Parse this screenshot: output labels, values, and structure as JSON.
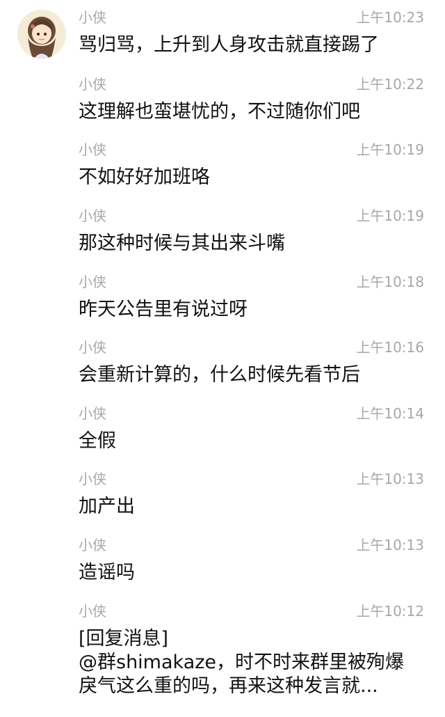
{
  "messages": [
    {
      "sender": "小侠",
      "time": "上午10:23",
      "lines": [
        "骂归骂，上升到人身攻击就直接踢了"
      ]
    },
    {
      "sender": "小侠",
      "time": "上午10:22",
      "lines": [
        "这理解也蛮堪忧的，不过随你们吧"
      ]
    },
    {
      "sender": "小侠",
      "time": "上午10:19",
      "lines": [
        "不如好好加班咯"
      ]
    },
    {
      "sender": "小侠",
      "time": "上午10:19",
      "lines": [
        "那这种时候与其出来斗嘴"
      ]
    },
    {
      "sender": "小侠",
      "time": "上午10:18",
      "lines": [
        "昨天公告里有说过呀"
      ]
    },
    {
      "sender": "小侠",
      "time": "上午10:16",
      "lines": [
        "会重新计算的，什么时候先看节后"
      ]
    },
    {
      "sender": "小侠",
      "time": "上午10:14",
      "lines": [
        "全假"
      ]
    },
    {
      "sender": "小侠",
      "time": "上午10:13",
      "lines": [
        "加产出"
      ]
    },
    {
      "sender": "小侠",
      "time": "上午10:13",
      "lines": [
        "造谣吗"
      ]
    },
    {
      "sender": "小侠",
      "time": "上午10:12",
      "lines": [
        "[回复消息]",
        "@群shimakaze，时不时来群里被殉爆",
        "戾气这么重的吗，再来这种发言就..."
      ]
    }
  ]
}
